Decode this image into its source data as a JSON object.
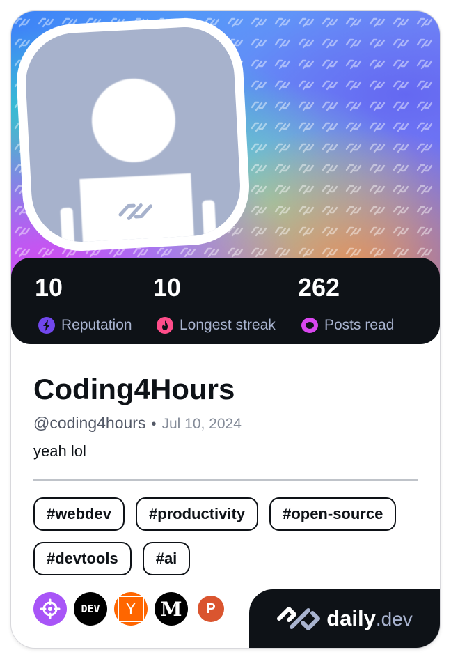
{
  "profile": {
    "name": "Coding4Hours",
    "handle": "@coding4hours",
    "separator": "•",
    "joined": "Jul 10, 2024",
    "bio": "yeah lol"
  },
  "stats": [
    {
      "value": "10",
      "label": "Reputation",
      "icon": "lightning-bolt-icon",
      "color": "#7147ed"
    },
    {
      "value": "10",
      "label": "Longest streak",
      "icon": "flame-icon",
      "color": "#ff4d8a"
    },
    {
      "value": "262",
      "label": "Posts read",
      "icon": "eye-ring-icon",
      "color": "#d946ef"
    }
  ],
  "tags": [
    "#webdev",
    "#productivity",
    "#open-source",
    "#devtools",
    "#ai"
  ],
  "sources": [
    {
      "name": "crosshair-source-icon",
      "color": "#a855f7"
    },
    {
      "name": "dev-source-icon",
      "label": "DEV",
      "color": "#000000"
    },
    {
      "name": "hacker-news-source-icon",
      "label": "Y",
      "color": "#ff6600"
    },
    {
      "name": "medium-source-icon",
      "label": "M",
      "color": "#000000"
    },
    {
      "name": "product-hunt-source-icon",
      "label": "P",
      "color": "#da552f"
    }
  ],
  "brand": {
    "name": "daily",
    "suffix": ".dev"
  },
  "colors": {
    "dark": "#0e1217",
    "secondary_text": "#a8b3cf",
    "hero_pink": "#d946ef",
    "hero_blue": "#3b82f6"
  }
}
